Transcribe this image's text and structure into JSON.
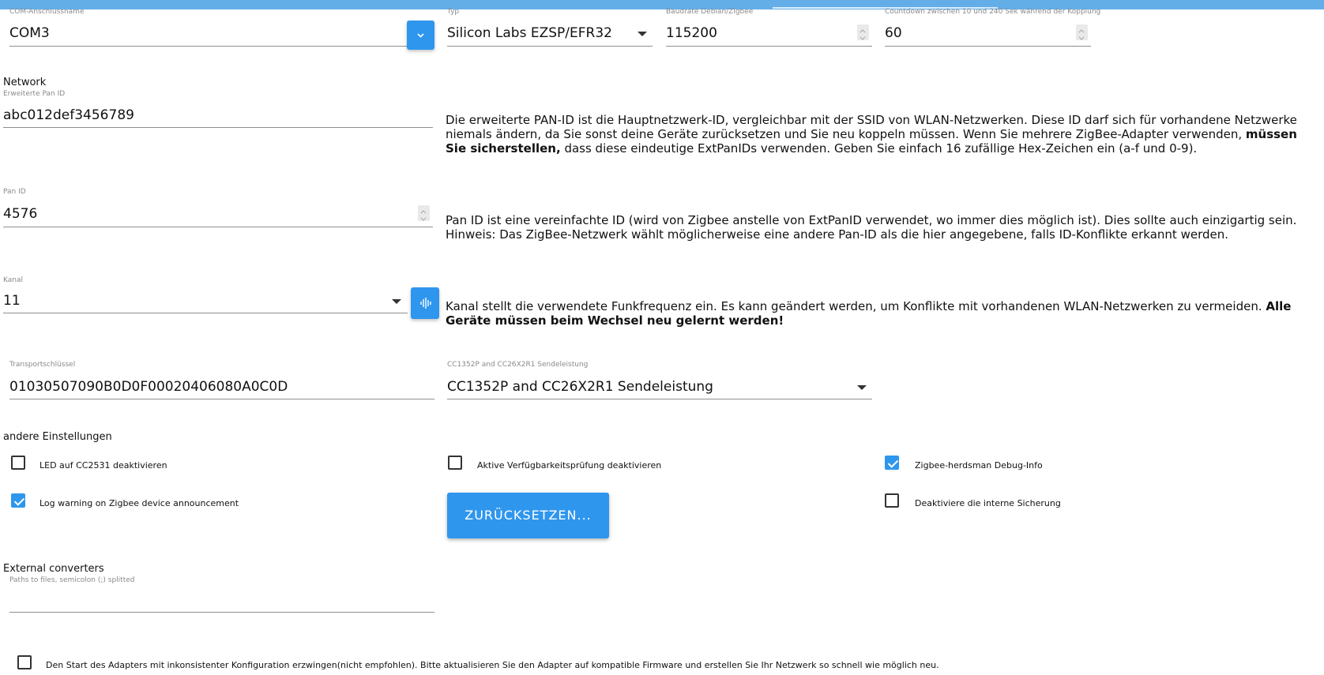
{
  "serial": {
    "port_label": "COM-Anschlussname",
    "port_value": "COM3",
    "type_label": "Typ",
    "type_value": "Silicon Labs EZSP/EFR32",
    "baud_label": "Baudrate Debian/Zigbee",
    "baud_value": "115200",
    "countdown_label": "Countdown zwischen 10 und 240 Sek während der Kopplung",
    "countdown_value": "60"
  },
  "network": {
    "title": "Network",
    "ext_pan_label": "Erweiterte Pan ID",
    "ext_pan_value": "abc012def3456789",
    "ext_pan_desc_1": "Die erweiterte PAN-ID ist die Hauptnetzwerk-ID, vergleichbar mit der SSID von WLAN-Netzwerken. Diese ID darf sich für vorhandene Netzwerke niemals ändern, da Sie sonst deine Geräte zurücksetzen und Sie neu koppeln müssen. Wenn Sie mehrere ZigBee-Adapter verwenden, ",
    "ext_pan_desc_bold": "müssen Sie sicherstellen,",
    "ext_pan_desc_2": " dass diese eindeutige ExtPanIDs verwenden. Geben Sie einfach 16 zufällige Hex-Zeichen ein (a-f und 0-9).",
    "pan_label": "Pan ID",
    "pan_value": "4576",
    "pan_desc": "Pan ID ist eine vereinfachte ID (wird von Zigbee anstelle von ExtPanID verwendet, wo immer dies möglich ist). Dies sollte auch einzigartig sein. Hinweis: Das ZigBee-Netzwerk wählt möglicherweise eine andere Pan-ID als die hier angegebene, falls ID-Konflikte erkannt werden.",
    "channel_label": "Kanal",
    "channel_value": "11",
    "channel_desc_1": "Kanal stellt die verwendete Funkfrequenz ein. Es kann geändert werden, um Konflikte mit vorhandenen WLAN-Netzwerken zu vermeiden. ",
    "channel_desc_bold": "Alle Geräte müssen beim Wechsel neu gelernt werden!",
    "transport_label": "Transportschlüssel",
    "transport_value": "01030507090B0D0F00020406080A0C0D",
    "power_label": "CC1352P and CC26X2R1 Sendeleistung",
    "power_value": "CC1352P and CC26X2R1 Sendeleistung"
  },
  "other": {
    "title": "andere Einstellungen",
    "options": [
      {
        "label": "LED auf CC2531 deaktivieren",
        "checked": false
      },
      {
        "label": "Aktive Verfügbarkeitsprüfung deaktivieren",
        "checked": false
      },
      {
        "label": "Zigbee-herdsman Debug-Info",
        "checked": true
      },
      {
        "label": "Log warning on Zigbee device announcement",
        "checked": true
      },
      {
        "label": "Deaktiviere die interne Sicherung",
        "checked": false
      }
    ],
    "reset_label": "ZURÜCKSETZEN..."
  },
  "converters": {
    "title": "External converters",
    "paths_label": "Paths to files, semicolon (;) splitted",
    "paths_value": ""
  },
  "force_start": {
    "label": "Den Start des Adapters mit inkonsistenter Konfiguration erzwingen(nicht empfohlen). Bitte aktualisieren Sie den Adapter auf kompatible Firmware und erstellen Sie Ihr Netzwerk so schnell wie möglich neu.",
    "checked": false
  },
  "icons": {
    "port_dropdown": "chevron-down-icon",
    "channel_scan": "signal-scan-icon"
  },
  "colors": {
    "accent": "#2f96ee",
    "topbar": "#64aee8"
  }
}
